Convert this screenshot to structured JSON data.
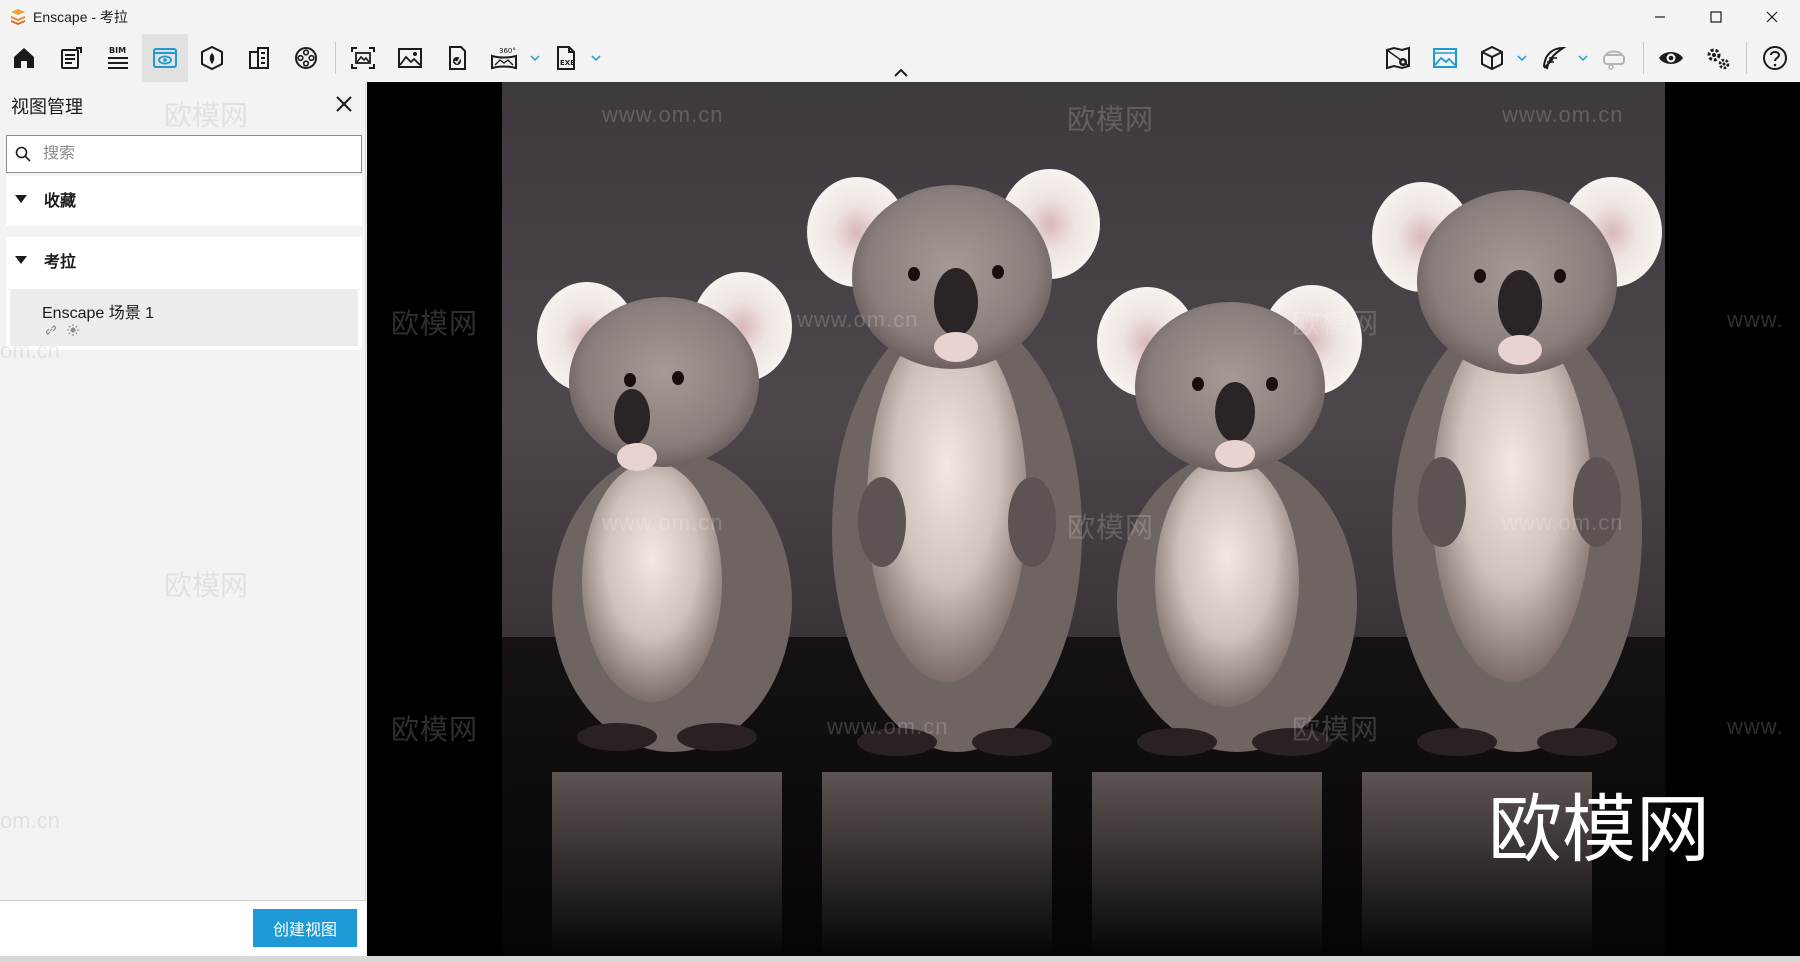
{
  "window": {
    "title": "Enscape - 考拉"
  },
  "toolbar": {
    "left_icons": [
      "home-icon",
      "edit-document-icon",
      "bim-icon",
      "visual-settings-icon",
      "asset-library-icon",
      "building-icon",
      "video-reel-icon",
      "screenshot-icon",
      "image-icon",
      "batch-render-icon",
      "panorama-360-icon",
      "exe-export-icon"
    ],
    "bim_label": "BIM",
    "pano_label": "360°",
    "exe_label": "EXE",
    "right_icons": [
      "map-location-icon",
      "image-view-icon",
      "cube-icon",
      "feather-icon",
      "vr-headset-icon",
      "eye-icon",
      "settings-icon",
      "help-icon"
    ]
  },
  "panel": {
    "title": "视图管理",
    "search_placeholder": "搜索",
    "sections": [
      {
        "label": "收藏",
        "items": []
      },
      {
        "label": "考拉",
        "items": [
          {
            "name": "Enscape 场景 1"
          }
        ]
      }
    ],
    "create_button": "创建视图"
  },
  "viewport": {
    "scene": "koala render",
    "watermark_text": "欧模网",
    "watermark_url": "www.om.cn",
    "watermark_big": "欧模网",
    "watermark_partial_url_left": "om.cn",
    "watermark_partial_url_right": "www."
  },
  "colors": {
    "accent": "#1e9ad6",
    "panel_bg": "#f3f3f3",
    "viewport_bg": "#000000"
  }
}
